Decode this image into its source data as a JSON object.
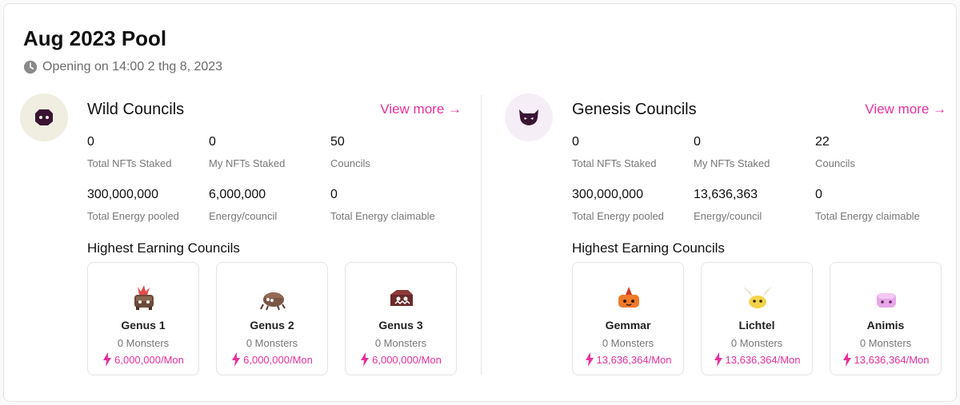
{
  "pool": {
    "title": "Aug 2023 Pool",
    "opening": "Opening on 14:00 2 thg 8, 2023",
    "clock_icon": "clock-icon"
  },
  "colors": {
    "accent": "#e8309c",
    "muted": "#777777",
    "wild_avatar_bg": "#efeee0",
    "genesis_avatar_bg": "#f6eef7",
    "avatar_fg": "#3a1432"
  },
  "wild": {
    "name": "Wild Councils",
    "view_more": "View more →",
    "icon": "wild-mask-icon",
    "stats": {
      "total_nfts_staked": "0",
      "total_nfts_staked_label": "Total NFTs Staked",
      "my_nfts_staked": "0",
      "my_nfts_staked_label": "My NFTs Staked",
      "councils": "50",
      "councils_label": "Councils",
      "total_energy_pooled": "300,000,000",
      "total_energy_pooled_label": "Total Energy pooled",
      "energy_per_council": "6,000,000",
      "energy_per_council_label": "Energy/council",
      "total_energy_claimable": "0",
      "total_energy_claimable_label": "Total Energy claimable"
    },
    "highest_label": "Highest Earning Councils",
    "top": [
      {
        "name": "Genus 1",
        "monsters": "0 Monsters",
        "rate": "6,000,000/Mon",
        "icon": "genus-1-monster-icon"
      },
      {
        "name": "Genus 2",
        "monsters": "0 Monsters",
        "rate": "6,000,000/Mon",
        "icon": "genus-2-monster-icon"
      },
      {
        "name": "Genus 3",
        "monsters": "0 Monsters",
        "rate": "6,000,000/Mon",
        "icon": "genus-3-monster-icon"
      }
    ]
  },
  "genesis": {
    "name": "Genesis Councils",
    "view_more": "View more →",
    "icon": "genesis-devil-mask-icon",
    "stats": {
      "total_nfts_staked": "0",
      "total_nfts_staked_label": "Total NFTs Staked",
      "my_nfts_staked": "0",
      "my_nfts_staked_label": "My NFTs Staked",
      "councils": "22",
      "councils_label": "Councils",
      "total_energy_pooled": "300,000,000",
      "total_energy_pooled_label": "Total Energy pooled",
      "energy_per_council": "13,636,363",
      "energy_per_council_label": "Energy/council",
      "total_energy_claimable": "0",
      "total_energy_claimable_label": "Total Energy claimable"
    },
    "highest_label": "Highest Earning Councils",
    "top": [
      {
        "name": "Gemmar",
        "monsters": "0 Monsters",
        "rate": "13,636,364/Mon",
        "icon": "gemmar-monster-icon"
      },
      {
        "name": "Lichtel",
        "monsters": "0 Monsters",
        "rate": "13,636,364/Mon",
        "icon": "lichtel-monster-icon"
      },
      {
        "name": "Animis",
        "monsters": "0 Monsters",
        "rate": "13,636,364/Mon",
        "icon": "animis-monster-icon"
      }
    ]
  }
}
